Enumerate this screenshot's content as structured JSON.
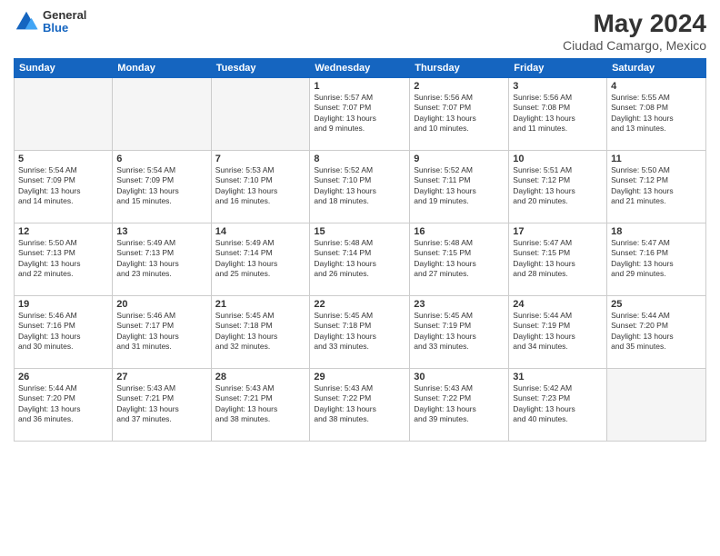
{
  "logo": {
    "general": "General",
    "blue": "Blue"
  },
  "title": "May 2024",
  "location": "Ciudad Camargo, Mexico",
  "headers": [
    "Sunday",
    "Monday",
    "Tuesday",
    "Wednesday",
    "Thursday",
    "Friday",
    "Saturday"
  ],
  "weeks": [
    [
      {
        "day": "",
        "info": ""
      },
      {
        "day": "",
        "info": ""
      },
      {
        "day": "",
        "info": ""
      },
      {
        "day": "1",
        "info": "Sunrise: 5:57 AM\nSunset: 7:07 PM\nDaylight: 13 hours\nand 9 minutes."
      },
      {
        "day": "2",
        "info": "Sunrise: 5:56 AM\nSunset: 7:07 PM\nDaylight: 13 hours\nand 10 minutes."
      },
      {
        "day": "3",
        "info": "Sunrise: 5:56 AM\nSunset: 7:08 PM\nDaylight: 13 hours\nand 11 minutes."
      },
      {
        "day": "4",
        "info": "Sunrise: 5:55 AM\nSunset: 7:08 PM\nDaylight: 13 hours\nand 13 minutes."
      }
    ],
    [
      {
        "day": "5",
        "info": "Sunrise: 5:54 AM\nSunset: 7:09 PM\nDaylight: 13 hours\nand 14 minutes."
      },
      {
        "day": "6",
        "info": "Sunrise: 5:54 AM\nSunset: 7:09 PM\nDaylight: 13 hours\nand 15 minutes."
      },
      {
        "day": "7",
        "info": "Sunrise: 5:53 AM\nSunset: 7:10 PM\nDaylight: 13 hours\nand 16 minutes."
      },
      {
        "day": "8",
        "info": "Sunrise: 5:52 AM\nSunset: 7:10 PM\nDaylight: 13 hours\nand 18 minutes."
      },
      {
        "day": "9",
        "info": "Sunrise: 5:52 AM\nSunset: 7:11 PM\nDaylight: 13 hours\nand 19 minutes."
      },
      {
        "day": "10",
        "info": "Sunrise: 5:51 AM\nSunset: 7:12 PM\nDaylight: 13 hours\nand 20 minutes."
      },
      {
        "day": "11",
        "info": "Sunrise: 5:50 AM\nSunset: 7:12 PM\nDaylight: 13 hours\nand 21 minutes."
      }
    ],
    [
      {
        "day": "12",
        "info": "Sunrise: 5:50 AM\nSunset: 7:13 PM\nDaylight: 13 hours\nand 22 minutes."
      },
      {
        "day": "13",
        "info": "Sunrise: 5:49 AM\nSunset: 7:13 PM\nDaylight: 13 hours\nand 23 minutes."
      },
      {
        "day": "14",
        "info": "Sunrise: 5:49 AM\nSunset: 7:14 PM\nDaylight: 13 hours\nand 25 minutes."
      },
      {
        "day": "15",
        "info": "Sunrise: 5:48 AM\nSunset: 7:14 PM\nDaylight: 13 hours\nand 26 minutes."
      },
      {
        "day": "16",
        "info": "Sunrise: 5:48 AM\nSunset: 7:15 PM\nDaylight: 13 hours\nand 27 minutes."
      },
      {
        "day": "17",
        "info": "Sunrise: 5:47 AM\nSunset: 7:15 PM\nDaylight: 13 hours\nand 28 minutes."
      },
      {
        "day": "18",
        "info": "Sunrise: 5:47 AM\nSunset: 7:16 PM\nDaylight: 13 hours\nand 29 minutes."
      }
    ],
    [
      {
        "day": "19",
        "info": "Sunrise: 5:46 AM\nSunset: 7:16 PM\nDaylight: 13 hours\nand 30 minutes."
      },
      {
        "day": "20",
        "info": "Sunrise: 5:46 AM\nSunset: 7:17 PM\nDaylight: 13 hours\nand 31 minutes."
      },
      {
        "day": "21",
        "info": "Sunrise: 5:45 AM\nSunset: 7:18 PM\nDaylight: 13 hours\nand 32 minutes."
      },
      {
        "day": "22",
        "info": "Sunrise: 5:45 AM\nSunset: 7:18 PM\nDaylight: 13 hours\nand 33 minutes."
      },
      {
        "day": "23",
        "info": "Sunrise: 5:45 AM\nSunset: 7:19 PM\nDaylight: 13 hours\nand 33 minutes."
      },
      {
        "day": "24",
        "info": "Sunrise: 5:44 AM\nSunset: 7:19 PM\nDaylight: 13 hours\nand 34 minutes."
      },
      {
        "day": "25",
        "info": "Sunrise: 5:44 AM\nSunset: 7:20 PM\nDaylight: 13 hours\nand 35 minutes."
      }
    ],
    [
      {
        "day": "26",
        "info": "Sunrise: 5:44 AM\nSunset: 7:20 PM\nDaylight: 13 hours\nand 36 minutes."
      },
      {
        "day": "27",
        "info": "Sunrise: 5:43 AM\nSunset: 7:21 PM\nDaylight: 13 hours\nand 37 minutes."
      },
      {
        "day": "28",
        "info": "Sunrise: 5:43 AM\nSunset: 7:21 PM\nDaylight: 13 hours\nand 38 minutes."
      },
      {
        "day": "29",
        "info": "Sunrise: 5:43 AM\nSunset: 7:22 PM\nDaylight: 13 hours\nand 38 minutes."
      },
      {
        "day": "30",
        "info": "Sunrise: 5:43 AM\nSunset: 7:22 PM\nDaylight: 13 hours\nand 39 minutes."
      },
      {
        "day": "31",
        "info": "Sunrise: 5:42 AM\nSunset: 7:23 PM\nDaylight: 13 hours\nand 40 minutes."
      },
      {
        "day": "",
        "info": ""
      }
    ]
  ]
}
